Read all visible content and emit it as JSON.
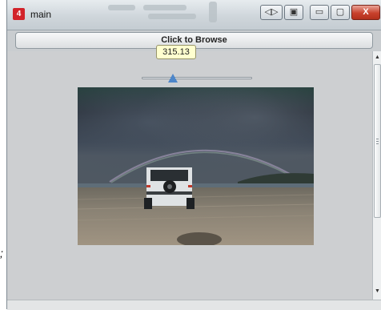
{
  "window": {
    "title": "main",
    "app_icon_glyph": "4",
    "buttons": {
      "tool1_icon": "◁▷",
      "tool2_icon": "▣",
      "minimize_icon": "▭",
      "maximize_icon": "▢",
      "close_icon": "X"
    }
  },
  "stray_char": ";",
  "browse": {
    "label": "Click to Browse"
  },
  "slider": {
    "tooltip_value": "315.13",
    "position_fraction": 0.28
  },
  "photo": {
    "subject": "car-on-beach-with-rainbow"
  },
  "colors": {
    "accent": "#4d86c9",
    "close_button": "#c8412c",
    "app_icon": "#d2232a"
  }
}
